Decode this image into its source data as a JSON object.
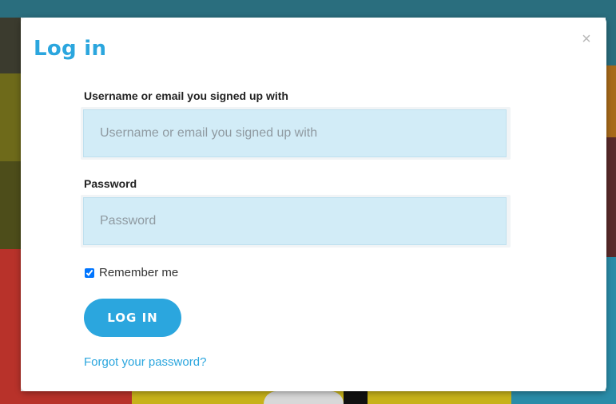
{
  "modal": {
    "title": "Log in",
    "close_symbol": "×"
  },
  "form": {
    "username_label": "Username or email you signed up with",
    "username_placeholder": "Username or email you signed up with",
    "username_value": "",
    "password_label": "Password",
    "password_placeholder": "Password",
    "password_value": "",
    "remember_label": "Remember me",
    "remember_checked": true,
    "submit_label": "LOG IN",
    "forgot_link": "Forgot your password?"
  },
  "colors": {
    "accent": "#2ba6de",
    "field_bg": "#d2ecf7"
  },
  "icons": {
    "close": "close-icon",
    "checkbox": "checkbox-checked"
  }
}
